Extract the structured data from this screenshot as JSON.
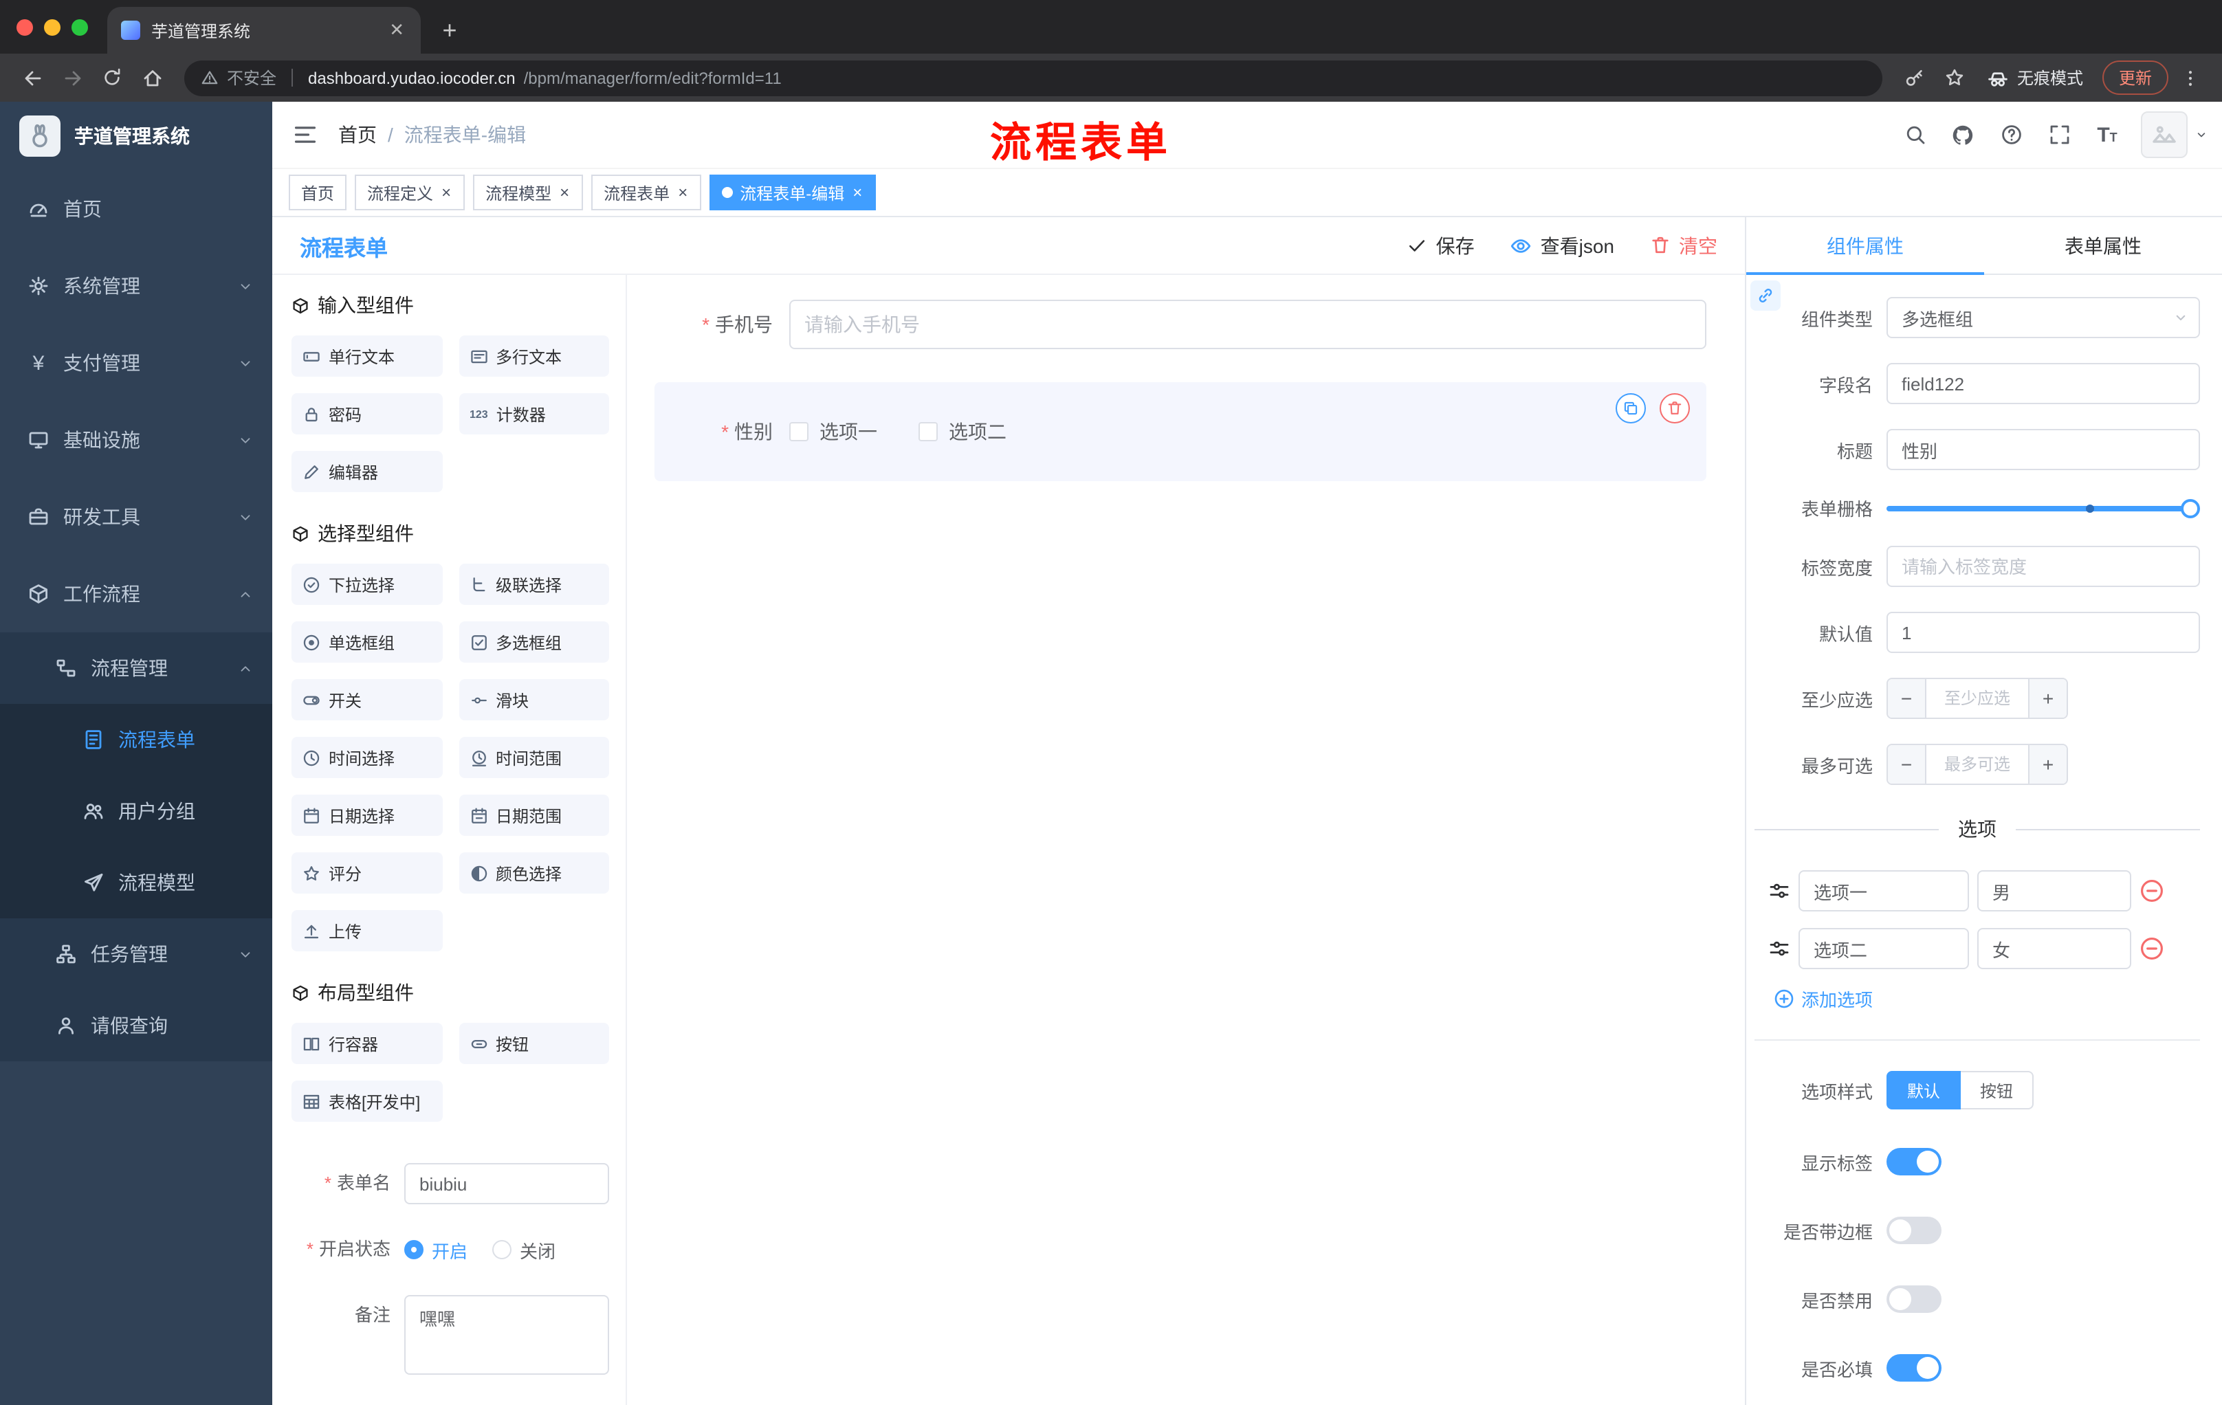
{
  "browser": {
    "tab_title": "芋道管理系统",
    "new_tab": "+",
    "security_label": "不安全",
    "url_domain": "dashboard.yudao.iocoder.cn",
    "url_path": "/bpm/manager/form/edit?formId=11",
    "incognito_label": "无痕模式",
    "update_label": "更新"
  },
  "sidebar": {
    "logo_title": "芋道管理系统",
    "items": [
      {
        "label": "首页"
      },
      {
        "label": "系统管理"
      },
      {
        "label": "支付管理"
      },
      {
        "label": "基础设施"
      },
      {
        "label": "研发工具"
      },
      {
        "label": "工作流程"
      },
      {
        "label": "流程管理"
      },
      {
        "label": "流程表单"
      },
      {
        "label": "用户分组"
      },
      {
        "label": "流程模型"
      },
      {
        "label": "任务管理"
      },
      {
        "label": "请假查询"
      }
    ]
  },
  "navbar": {
    "breadcrumb_home": "首页",
    "breadcrumb_current": "流程表单-编辑",
    "annotation": "流程表单"
  },
  "tags": [
    {
      "label": "首页"
    },
    {
      "label": "流程定义"
    },
    {
      "label": "流程模型"
    },
    {
      "label": "流程表单"
    },
    {
      "label": "流程表单-编辑"
    }
  ],
  "designer": {
    "title": "流程表单",
    "save": "保存",
    "view_json": "查看json",
    "clear": "清空",
    "palette": {
      "groups": [
        {
          "title": "输入型组件",
          "items": [
            "单行文本",
            "多行文本",
            "密码",
            "计数器",
            "编辑器"
          ]
        },
        {
          "title": "选择型组件",
          "items": [
            "下拉选择",
            "级联选择",
            "单选框组",
            "多选框组",
            "开关",
            "滑块",
            "时间选择",
            "时间范围",
            "日期选择",
            "日期范围",
            "评分",
            "颜色选择",
            "上传"
          ]
        },
        {
          "title": "布局型组件",
          "items": [
            "行容器",
            "按钮",
            "表格[开发中]"
          ]
        }
      ]
    },
    "meta": {
      "name_label": "表单名",
      "name_value": "biubiu",
      "status_label": "开启状态",
      "status_on": "开启",
      "status_off": "关闭",
      "remark_label": "备注",
      "remark_value": "嘿嘿"
    },
    "canvas": {
      "phone_label": "手机号",
      "phone_placeholder": "请输入手机号",
      "gender_label": "性别",
      "gender_opt1": "选项一",
      "gender_opt2": "选项二"
    }
  },
  "props": {
    "tab_component": "组件属性",
    "tab_form": "表单属性",
    "component_type_label": "组件类型",
    "component_type_value": "多选框组",
    "field_name_label": "字段名",
    "field_name_value": "field122",
    "title_label": "标题",
    "title_value": "性别",
    "grid_label": "表单栅格",
    "label_width_label": "标签宽度",
    "label_width_placeholder": "请输入标签宽度",
    "default_label": "默认值",
    "default_value": "1",
    "min_label": "至少应选",
    "min_placeholder": "至少应选",
    "max_label": "最多可选",
    "max_placeholder": "最多可选",
    "options_title": "选项",
    "options": [
      {
        "label": "选项一",
        "value": "男"
      },
      {
        "label": "选项二",
        "value": "女"
      }
    ],
    "add_option": "添加选项",
    "style_label": "选项样式",
    "style_default": "默认",
    "style_button": "按钮",
    "show_label": "显示标签",
    "show_label_on": true,
    "border_label": "是否带边框",
    "border_on": false,
    "disabled_label": "是否禁用",
    "disabled_on": false,
    "required_label": "是否必填",
    "required_on": true
  },
  "colors": {
    "accent": "#409eff",
    "danger": "#f56c6c",
    "annotation": "#fe1000",
    "sidebar_bg": "#304156",
    "traffic": [
      "#ff5f57",
      "#febc2e",
      "#28c840"
    ]
  }
}
